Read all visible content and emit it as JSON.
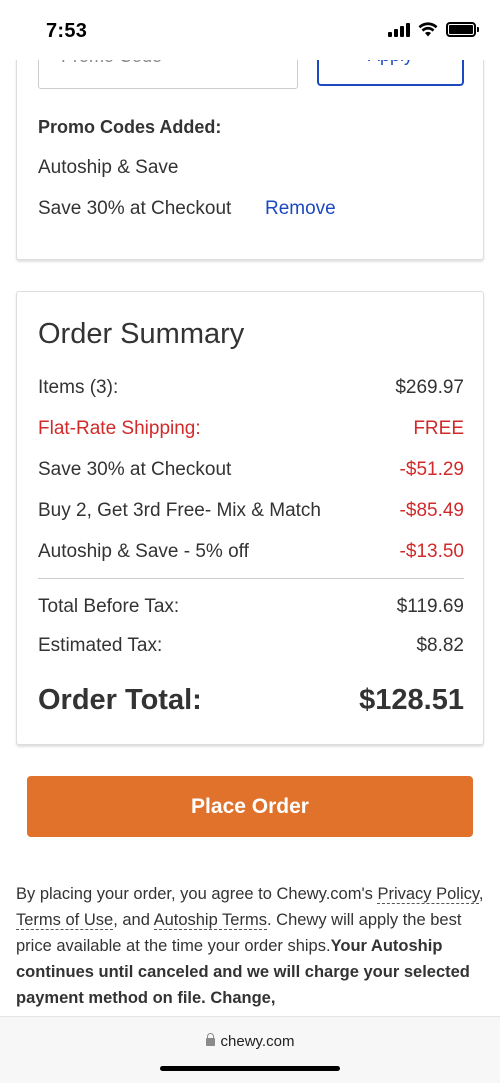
{
  "status_bar": {
    "time": "7:53",
    "icons": [
      "signal-icon",
      "wifi-icon",
      "battery-icon"
    ]
  },
  "promo": {
    "input_placeholder": "Promo Code",
    "apply_label": "Apply",
    "added_title": "Promo Codes Added:",
    "codes": [
      "Autoship & Save",
      "Save 30% at Checkout"
    ],
    "remove_label": "Remove"
  },
  "summary": {
    "title": "Order Summary",
    "lines": [
      {
        "label": "Items (3):",
        "value": "$269.97",
        "highlight": false
      },
      {
        "label": "Flat-Rate Shipping:",
        "value": "FREE",
        "highlight": true
      },
      {
        "label": "Save 30% at Checkout",
        "value": "-$51.29",
        "highlight": false
      },
      {
        "label": "Buy 2, Get 3rd Free- Mix & Match",
        "value": "-$85.49",
        "highlight": false
      },
      {
        "label": "Autoship & Save - 5% off",
        "value": "-$13.50",
        "highlight": false
      }
    ],
    "total_before_tax_label": "Total Before Tax:",
    "total_before_tax": "$119.69",
    "estimated_tax_label": "Estimated Tax:",
    "estimated_tax": "$8.82",
    "order_total_label": "Order Total:",
    "order_total": "$128.51"
  },
  "place_order_label": "Place Order",
  "legal": {
    "p1": "By placing your order, you agree to Chewy.com's ",
    "privacy_link": "Privacy Policy",
    "p2": ", ",
    "terms_link": "Terms of Use",
    "p3": ", and ",
    "autoship_link": "Autoship Terms",
    "p4": ". Chewy will apply the best price available at the time your order ships.",
    "bold": "Your Autoship continues until canceled and we will charge your selected payment method on file. Change,"
  },
  "browser": {
    "url": "chewy.com"
  },
  "colors": {
    "accent_orange": "#e0722c",
    "link_blue": "#1c49c2",
    "discount_red": "#d12a2a",
    "text": "#333333"
  }
}
